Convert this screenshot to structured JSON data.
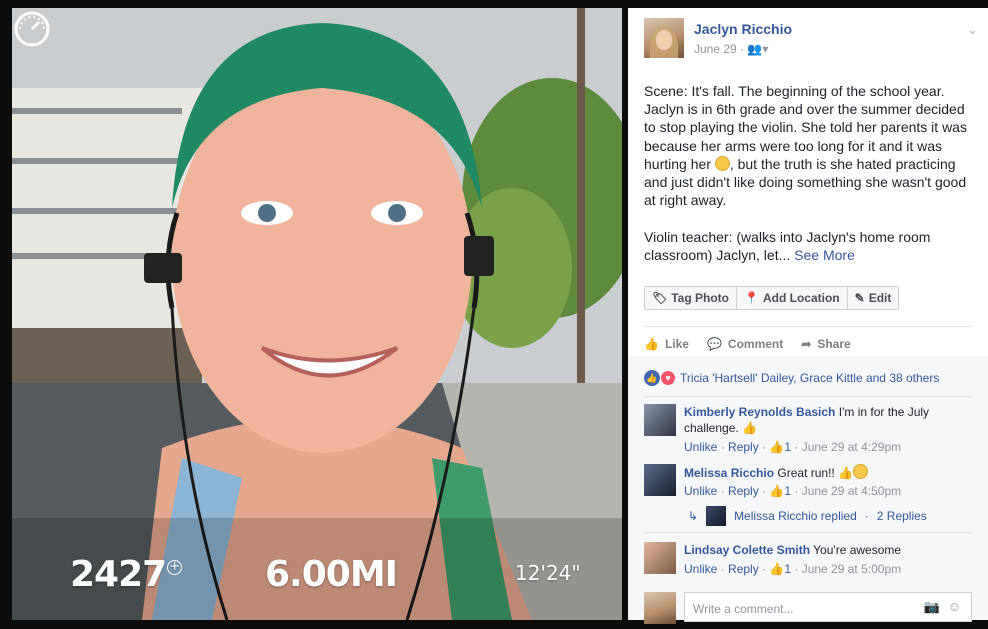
{
  "photo": {
    "stats": {
      "calories": "2427",
      "distance": "6.00MI",
      "pace": "12'24\""
    },
    "calories_plus_icon": "plus-circle-icon",
    "pace_icon": "stopwatch-icon"
  },
  "post": {
    "author": "Jaclyn Ricchio",
    "date": "June 29",
    "audience_icon": "friends-icon",
    "body_part1": "Scene: It's fall. The beginning of the school year. Jaclyn is in 6th grade and over the summer decided to stop playing the violin. She told her parents it was because her arms were too long for it and it was hurting her ",
    "body_part2": ", but the truth is she hated practicing and just didn't like doing something she wasn't good at right away.\n\nViolin teacher: (walks into Jaclyn's home room classroom) Jaclyn, let... ",
    "see_more": "See More",
    "emoji": "grimace-emoji",
    "actions": {
      "tag_photo": "Tag Photo",
      "add_location": "Add Location",
      "edit": "Edit"
    },
    "feedback": {
      "like": "Like",
      "comment": "Comment",
      "share": "Share"
    }
  },
  "reactions": {
    "text": "Tricia 'Hartsell' Dailey, Grace Kittle and 38 others"
  },
  "comments": [
    {
      "name": "Kimberly Reynolds Basich",
      "text": "I'm in for the July challenge.",
      "unlike": "Unlike",
      "reply": "Reply",
      "likes": "1",
      "time": "June 29 at 4:29pm"
    },
    {
      "name": "Melissa Ricchio",
      "text": "Great run!!",
      "unlike": "Unlike",
      "reply": "Reply",
      "likes": "1",
      "time": "June 29 at 4:50pm"
    },
    {
      "name": "Lindsay Colette Smith",
      "text": "You're awesome",
      "unlike": "Unlike",
      "reply": "Reply",
      "likes": "1",
      "time": "June 29 at 5:00pm"
    }
  ],
  "replied": {
    "text": "Melissa Ricchio replied",
    "replies": "2 Replies"
  },
  "write_comment": {
    "placeholder": "Write a comment..."
  },
  "colors": {
    "link": "#365899",
    "muted": "#90949c",
    "like_blue": "#4267b2",
    "love_red": "#f25268"
  }
}
